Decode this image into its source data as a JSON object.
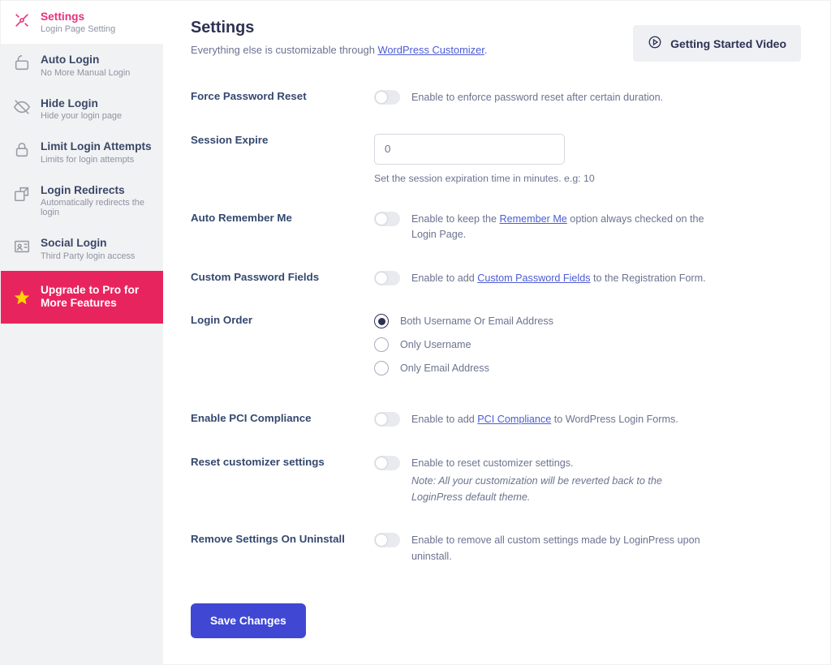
{
  "sidebar": {
    "items": [
      {
        "title": "Settings",
        "sub": "Login Page Setting",
        "iconName": "settings-icon"
      },
      {
        "title": "Auto Login",
        "sub": "No More Manual Login",
        "iconName": "auto-login-icon"
      },
      {
        "title": "Hide Login",
        "sub": "Hide your login page",
        "iconName": "hide-login-icon"
      },
      {
        "title": "Limit Login Attempts",
        "sub": "Limits for login attempts",
        "iconName": "limit-attempts-icon"
      },
      {
        "title": "Login Redirects",
        "sub": "Automatically redirects the login",
        "iconName": "redirects-icon"
      },
      {
        "title": "Social Login",
        "sub": "Third Party login access",
        "iconName": "social-login-icon"
      }
    ],
    "upgrade": {
      "title": "Upgrade to Pro for More Features"
    }
  },
  "header": {
    "title": "Settings",
    "subline_prefix": "Everything else is customizable through ",
    "subline_link": "WordPress Customizer",
    "subline_suffix": ".",
    "getting_started": "Getting Started Video"
  },
  "settings": {
    "force_pw": {
      "label": "Force Password Reset",
      "desc": "Enable to enforce password reset after certain duration."
    },
    "session": {
      "label": "Session Expire",
      "value": "0",
      "hint": "Set the session expiration time in minutes. e.g: 10"
    },
    "remember": {
      "label": "Auto Remember Me",
      "pre": "Enable to keep the ",
      "link": "Remember Me",
      "post": " option always checked on the Login Page."
    },
    "custompw": {
      "label": "Custom Password Fields",
      "pre": "Enable to add ",
      "link": "Custom Password Fields",
      "post": " to the Registration Form."
    },
    "order": {
      "label": "Login Order",
      "options": [
        "Both Username Or Email Address",
        "Only Username",
        "Only Email Address"
      ],
      "selected": 0
    },
    "pci": {
      "label": "Enable PCI Compliance",
      "pre": "Enable to add ",
      "link": "PCI Compliance",
      "post": " to WordPress Login Forms."
    },
    "reset": {
      "label": "Reset customizer settings",
      "desc": "Enable to reset customizer settings.",
      "note": "Note: All your customization will be reverted back to the LoginPress default theme."
    },
    "uninstall": {
      "label": "Remove Settings On Uninstall",
      "desc": "Enable to remove all custom settings made by LoginPress upon uninstall."
    }
  },
  "buttons": {
    "save": "Save Changes"
  }
}
